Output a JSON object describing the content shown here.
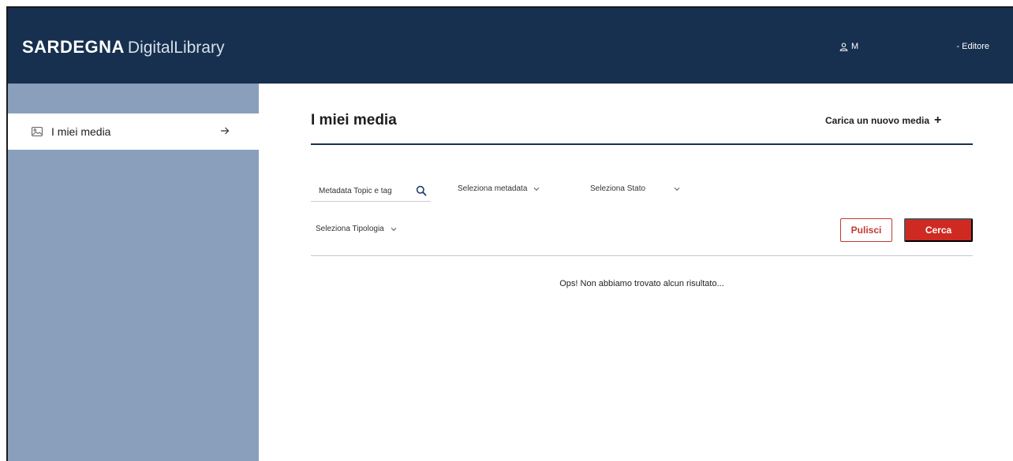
{
  "header": {
    "brand_bold": "SARDEGNA",
    "brand_light": "DigitalLibrary",
    "user_initial": "M",
    "role": "- Editore"
  },
  "sidebar": {
    "items": [
      {
        "label": "I miei media",
        "icon": "image-icon",
        "active": true
      }
    ]
  },
  "main": {
    "title": "I miei media",
    "upload_label": "Carica un nuovo media",
    "search": {
      "placeholder": "Metadata Topic e tag",
      "value": ""
    },
    "filters": {
      "metadata": "Seleziona metadata",
      "stato": "Seleziona Stato",
      "tipologia": "Seleziona Tipologia"
    },
    "buttons": {
      "clear": "Pulisci",
      "search": "Cerca"
    },
    "empty_message": "Ops! Non abbiamo trovato alcun risultato..."
  },
  "colors": {
    "header_bg": "#17304f",
    "sidebar_bg": "#8a9fbc",
    "accent_red": "#cf2a21"
  }
}
